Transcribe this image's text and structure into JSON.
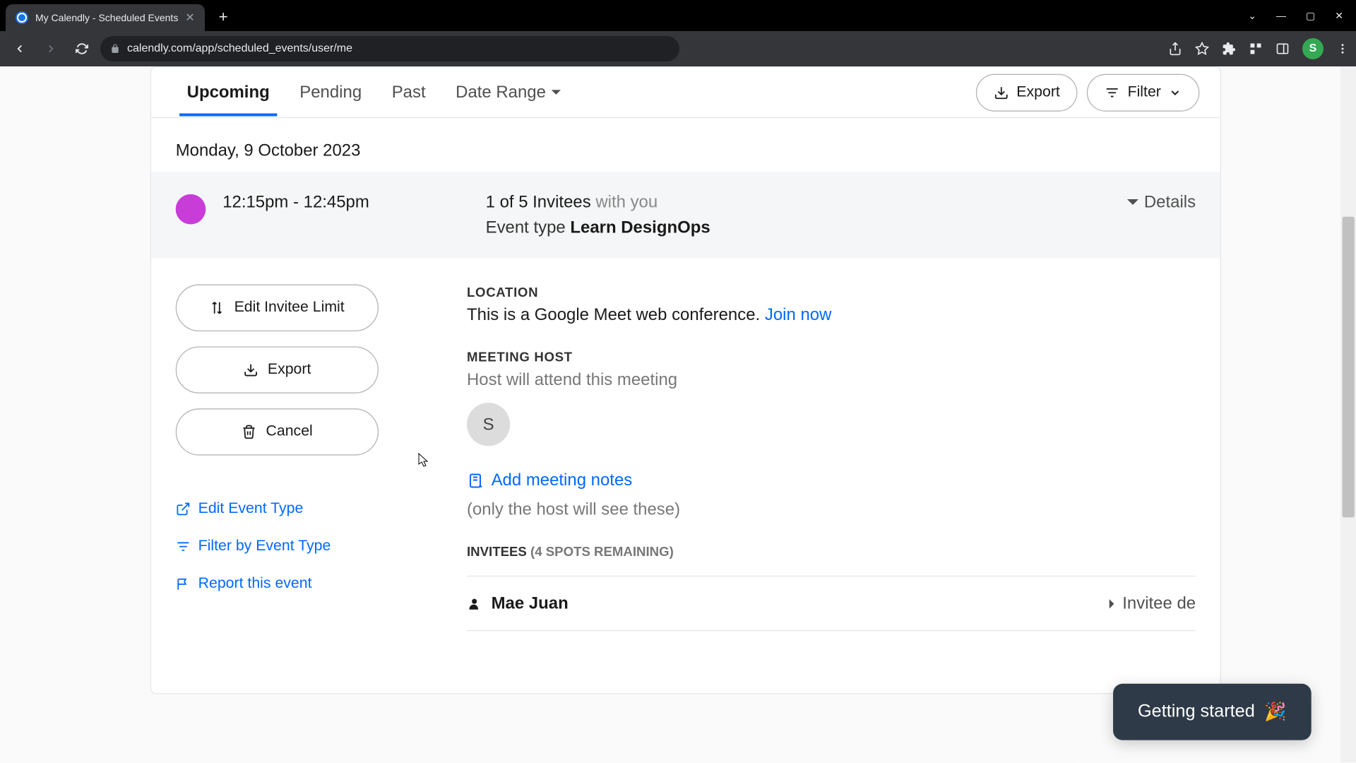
{
  "browser": {
    "tab_title": "My Calendly - Scheduled Events",
    "url": "calendly.com/app/scheduled_events/user/me",
    "profile_initial": "S"
  },
  "tabs": {
    "upcoming": "Upcoming",
    "pending": "Pending",
    "past": "Past",
    "date_range": "Date Range"
  },
  "toolbar": {
    "export": "Export",
    "filter": "Filter"
  },
  "date_header": "Monday, 9 October 2023",
  "event": {
    "time": "12:15pm - 12:45pm",
    "invitee_count": "1 of 5 Invitees",
    "with_you": "with you",
    "event_type_label": "Event type",
    "event_type_name": "Learn DesignOps",
    "details_label": "Details",
    "color": "#c83cd8"
  },
  "actions": {
    "edit_limit": "Edit Invitee Limit",
    "export": "Export",
    "cancel": "Cancel",
    "edit_event_type": "Edit Event Type",
    "filter_by_type": "Filter by Event Type",
    "report": "Report this event"
  },
  "details": {
    "location_label": "LOCATION",
    "location_text": "This is a Google Meet web conference.",
    "join_now": "Join now",
    "host_label": "MEETING HOST",
    "host_attend": "Host will attend this meeting",
    "host_initial": "S",
    "add_notes": "Add meeting notes",
    "notes_hint": "(only the host will see these)",
    "invitees_label": "INVITEES",
    "spots_remaining": "(4 SPOTS REMAINING)",
    "invitee_name": "Mae Juan",
    "invitee_details": "Invitee de"
  },
  "widget": {
    "getting_started": "Getting started"
  }
}
